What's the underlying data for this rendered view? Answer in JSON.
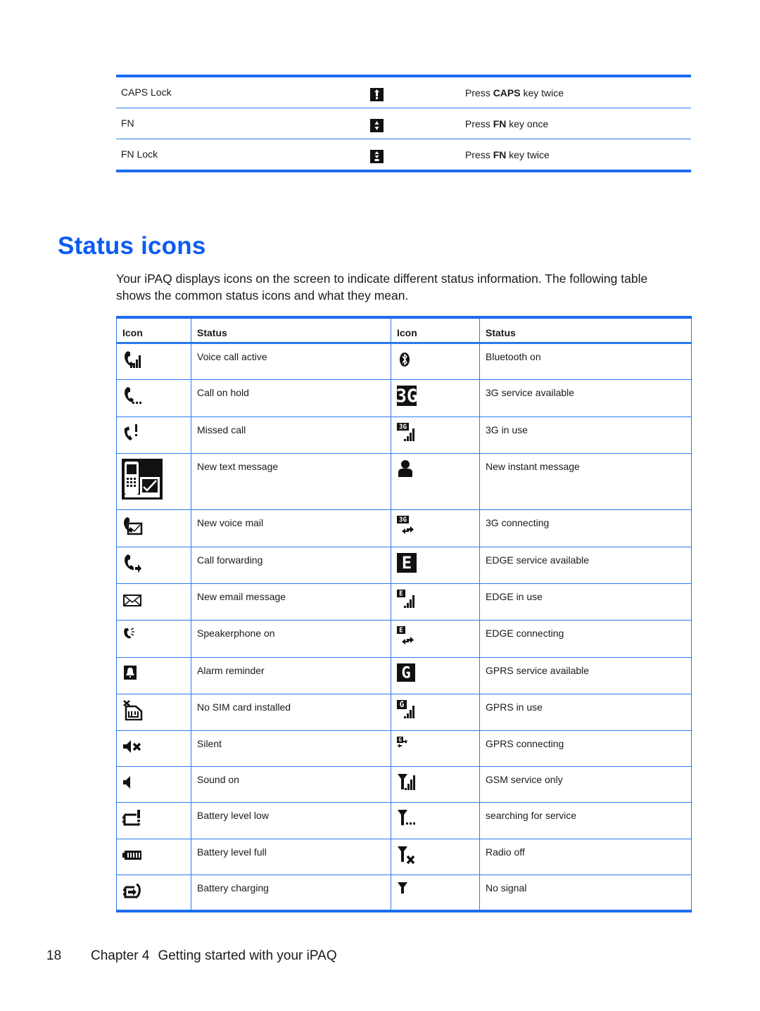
{
  "key_table": {
    "rows": [
      {
        "name": "CAPS Lock",
        "icon": "caps-lock-icon",
        "desc_pre": "Press ",
        "desc_bold": "CAPS",
        "desc_post": " key twice"
      },
      {
        "name": "FN",
        "icon": "fn-icon",
        "desc_pre": "Press ",
        "desc_bold": "FN",
        "desc_post": " key once"
      },
      {
        "name": "FN Lock",
        "icon": "fn-lock-icon",
        "desc_pre": "Press ",
        "desc_bold": "FN",
        "desc_post": " key twice"
      }
    ]
  },
  "section": {
    "title": "Status icons",
    "intro": "Your iPAQ displays icons on the screen to indicate different status information. The following table shows the common status icons and what they mean."
  },
  "status_table": {
    "headers": [
      "Icon",
      "Status",
      "Icon",
      "Status"
    ],
    "rows": [
      {
        "left_icon": "voice-call-active-icon",
        "left": "Voice call active",
        "right_icon": "bluetooth-icon",
        "right": "Bluetooth on"
      },
      {
        "left_icon": "call-on-hold-icon",
        "left": "Call on hold",
        "right_icon": "3g-available-icon",
        "right": "3G service available"
      },
      {
        "left_icon": "missed-call-icon",
        "left": "Missed call",
        "right_icon": "3g-in-use-icon",
        "right": "3G in use"
      },
      {
        "left_icon": "new-text-message-icon",
        "left": "New text message",
        "right_icon": "instant-message-icon",
        "right": "New instant message"
      },
      {
        "left_icon": "new-voice-mail-icon",
        "left": "New voice mail",
        "right_icon": "3g-connecting-icon",
        "right": "3G connecting"
      },
      {
        "left_icon": "call-forwarding-icon",
        "left": "Call forwarding",
        "right_icon": "edge-available-icon",
        "right": "EDGE service available"
      },
      {
        "left_icon": "email-icon",
        "left": "New email message",
        "right_icon": "edge-in-use-icon",
        "right": "EDGE in use"
      },
      {
        "left_icon": "speakerphone-icon",
        "left": "Speakerphone on",
        "right_icon": "edge-connecting-icon",
        "right": "EDGE connecting"
      },
      {
        "left_icon": "alarm-icon",
        "left": "Alarm reminder",
        "right_icon": "gprs-available-icon",
        "right": "GPRS service available"
      },
      {
        "left_icon": "no-sim-icon",
        "left": "No SIM card installed",
        "right_icon": "gprs-in-use-icon",
        "right": "GPRS in use"
      },
      {
        "left_icon": "silent-icon",
        "left": "Silent",
        "right_icon": "gprs-connecting-icon",
        "right": "GPRS connecting"
      },
      {
        "left_icon": "sound-on-icon",
        "left": "Sound on",
        "right_icon": "gsm-only-icon",
        "right": "GSM service only"
      },
      {
        "left_icon": "battery-low-icon",
        "left": "Battery level low",
        "right_icon": "searching-service-icon",
        "right": "searching for service"
      },
      {
        "left_icon": "battery-full-icon",
        "left": "Battery level full",
        "right_icon": "radio-off-icon",
        "right": "Radio off"
      },
      {
        "left_icon": "battery-charging-icon",
        "left": "Battery charging",
        "right_icon": "no-signal-icon",
        "right": "No signal"
      }
    ]
  },
  "footer": {
    "page_number": "18",
    "chapter": "Chapter 4",
    "chapter_title": "Getting started with your iPAQ"
  },
  "colors": {
    "accent_blue": "#0b5cf5",
    "rule_blue": "#1a6cf0",
    "icon_black": "#111111"
  }
}
